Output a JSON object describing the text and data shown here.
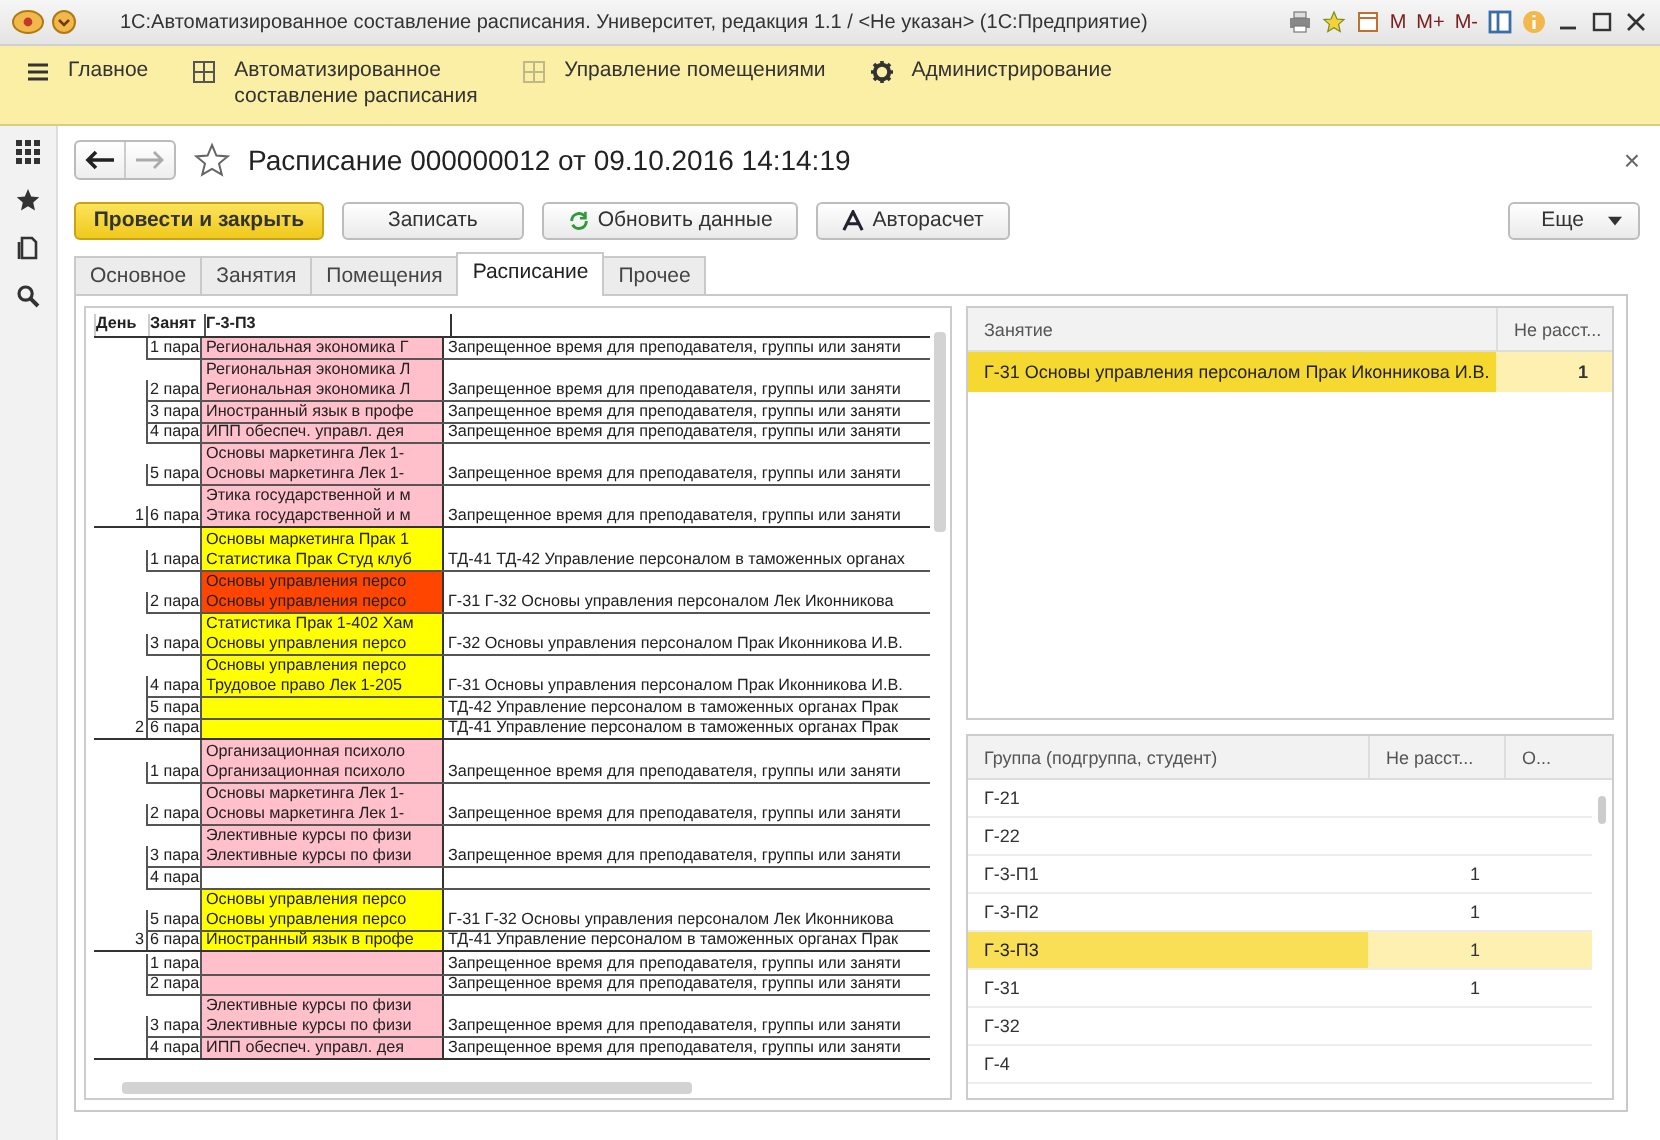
{
  "window": {
    "title": "1С:Автоматизированное составление расписания. Университет, редакция 1.1 / <Не указан>  (1С:Предприятие)",
    "memory_keys": [
      "M",
      "M+",
      "M-"
    ]
  },
  "sections": [
    {
      "label": "Главное",
      "kind": "menu"
    },
    {
      "label": "Автоматизированное составление расписания",
      "kind": "section"
    },
    {
      "label": "Управление помещениями",
      "kind": "unavailable"
    },
    {
      "label": "Администрирование",
      "kind": "settings"
    }
  ],
  "form": {
    "title": "Расписание 000000012 от 09.10.2016 14:14:19",
    "close": "×"
  },
  "buttons": [
    {
      "label": "Провести и закрыть",
      "kind": "primary"
    },
    {
      "label": "Записать",
      "kind": "plain"
    },
    {
      "label": "Обновить данные",
      "kind": "refresh"
    },
    {
      "label": "Авторасчет",
      "kind": "auto"
    }
  ],
  "more_button": {
    "label": "Еще"
  },
  "tabs": [
    {
      "label": "Основное",
      "selected": false
    },
    {
      "label": "Занятия",
      "selected": false
    },
    {
      "label": "Помещения",
      "selected": false
    },
    {
      "label": "Расписание",
      "selected": true
    },
    {
      "label": "Прочее",
      "selected": false
    }
  ],
  "schedule": {
    "columns": [
      "День",
      "Занят",
      "Г-3-П3"
    ],
    "days": [
      {
        "day": "1",
        "slots": [
          {
            "lesson": "1 пара",
            "lines": [
              "Региональная экономика Г"
            ],
            "color": "#ffc0cb",
            "note": "Запрещенное время для преподавателя, группы или заняти"
          },
          {
            "lesson": "2 пара",
            "lines": [
              "Региональная экономика Л",
              "Региональная экономика Л"
            ],
            "color": "#ffc0cb",
            "note": "Запрещенное время для преподавателя, группы или заняти"
          },
          {
            "lesson": "3 пара",
            "lines": [
              "Иностранный язык в профе"
            ],
            "color": "#ffc0cb",
            "note": "Запрещенное время для преподавателя, группы или заняти"
          },
          {
            "lesson": "4 пара",
            "lines": [
              "ИПП обеспеч. управл. дея"
            ],
            "color": "#ffc0cb",
            "note": "Запрещенное время для преподавателя, группы или заняти"
          },
          {
            "lesson": "5 пара",
            "lines": [
              "Основы маркетинга Лек 1-",
              "Основы маркетинга Лек 1-"
            ],
            "color": "#ffc0cb",
            "note": "Запрещенное время для преподавателя, группы или заняти"
          },
          {
            "lesson": "6 пара",
            "lines": [
              "Этика государственной и м",
              "Этика государственной и м"
            ],
            "color": "#ffc0cb",
            "note": "Запрещенное время для преподавателя, группы или заняти"
          }
        ]
      },
      {
        "day": "2",
        "slots": [
          {
            "lesson": "1 пара",
            "lines": [
              "Основы маркетинга Прак 1",
              "Статистика Прак Студ клуб"
            ],
            "color": "#ffff00",
            "note": "ТД-41 ТД-42 Управление персоналом в таможенных органах"
          },
          {
            "lesson": "2 пара",
            "lines": [
              "Основы управления персо",
              "Основы управления персо"
            ],
            "color": "#ff4500",
            "note": "Г-31 Г-32 Основы управления персоналом Лек Иконникова"
          },
          {
            "lesson": "3 пара",
            "lines": [
              "Статистика Прак 1-402 Хам",
              "Основы управления персо"
            ],
            "color": "#ffff00",
            "note": "Г-32 Основы управления персоналом Прак Иконникова И.В."
          },
          {
            "lesson": "4 пара",
            "lines": [
              "Основы управления персо",
              "Трудовое право Лек 1-205"
            ],
            "color": "#ffff00",
            "note": "Г-31 Основы управления персоналом Прак Иконникова И.В."
          },
          {
            "lesson": "5 пара",
            "color": "#ffff00",
            "note": "ТД-42 Управление персоналом в таможенных органах Прак"
          },
          {
            "lesson": "6 пара",
            "color": "#ffff00",
            "note": "ТД-41 Управление персоналом в таможенных органах Прак"
          }
        ]
      },
      {
        "day": "3",
        "slots": [
          {
            "lesson": "1 пара",
            "lines": [
              "Организационная психоло",
              "Организационная психоло"
            ],
            "color": "#ffc0cb",
            "note": "Запрещенное время для преподавателя, группы или заняти"
          },
          {
            "lesson": "2 пара",
            "lines": [
              "Основы маркетинга Лек 1-",
              "Основы маркетинга Лек 1-"
            ],
            "color": "#ffc0cb",
            "note": "Запрещенное время для преподавателя, группы или заняти"
          },
          {
            "lesson": "3 пара",
            "lines": [
              "Элективные курсы по физи",
              "Элективные курсы по физи"
            ],
            "color": "#ffc0cb",
            "note": "Запрещенное время для преподавателя, группы или заняти"
          },
          {
            "lesson": "4 пара"
          },
          {
            "lesson": "5 пара",
            "lines": [
              "Основы управления персо",
              "Основы управления персо"
            ],
            "color": "#ffff00",
            "note": "Г-31 Г-32 Основы управления персоналом Лек Иконникова"
          },
          {
            "lesson": "6 пара",
            "lines": [
              "Иностранный язык в профе"
            ],
            "color": "#ffff00",
            "note": "ТД-41 Управление персоналом в таможенных органах Прак"
          }
        ]
      },
      {
        "slots": [
          {
            "lesson": "1 пара",
            "color": "#ffc0cb",
            "note": "Запрещенное время для преподавателя, группы или заняти"
          },
          {
            "lesson": "2 пара",
            "color": "#ffc0cb",
            "note": "Запрещенное время для преподавателя, группы или заняти"
          },
          {
            "lesson": "3 пара",
            "lines": [
              "Элективные курсы по физи",
              "Элективные курсы по физи"
            ],
            "color": "#ffc0cb",
            "note": "Запрещенное время для преподавателя, группы или заняти"
          },
          {
            "lesson": "4 пара",
            "lines": [
              "ИПП обеспеч. управл. дея"
            ],
            "color": "#ffc0cb",
            "note": "Запрещенное время для преподавателя, группы или заняти"
          }
        ]
      }
    ]
  },
  "lessons_table": {
    "columns": [
      "Занятие",
      "Не расст..."
    ],
    "rows": [
      {
        "cells": [
          "Г-31 Основы управления персоналом Прак Иконникова И.В.",
          "1"
        ],
        "selected": true
      }
    ]
  },
  "groups_table": {
    "columns": [
      "Группа (подгруппа, студент)",
      "Не расст...",
      "О..."
    ],
    "rows": [
      {
        "name": "Г-21",
        "selected": false
      },
      {
        "name": "Г-22",
        "selected": false
      },
      {
        "name": "Г-3-П1",
        "unplaced": "1",
        "selected": false
      },
      {
        "name": "Г-3-П2",
        "unplaced": "1",
        "selected": false
      },
      {
        "name": "Г-3-П3",
        "unplaced": "1",
        "selected": true
      },
      {
        "name": "Г-31",
        "unplaced": "1",
        "selected": false
      },
      {
        "name": "Г-32",
        "selected": false
      },
      {
        "name": "Г-4",
        "selected": false
      }
    ]
  }
}
